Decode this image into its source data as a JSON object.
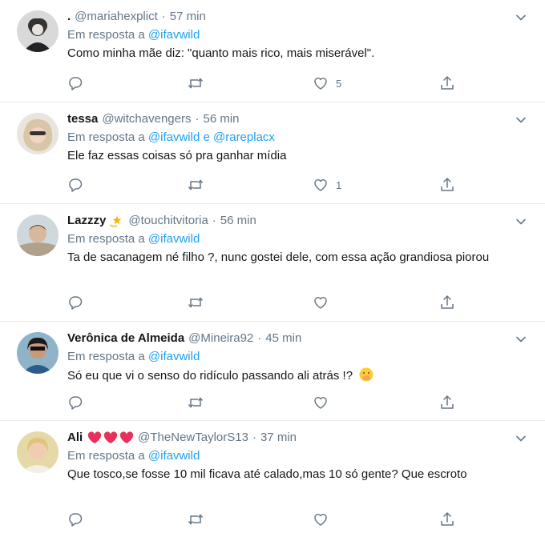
{
  "reply_prefix": "Em resposta a",
  "reply_joiner": "e",
  "tweets": [
    {
      "name": ".",
      "handle": "@mariahexplict",
      "time": "57 min",
      "reply_to": [
        "@ifavwild"
      ],
      "text": "Como minha mãe diz: \"quanto mais rico, mais miserável\".",
      "likes": "5",
      "avatar_icon": "avatar-photo"
    },
    {
      "name": "tessa",
      "handle": "@witchavengers",
      "time": "56 min",
      "reply_to": [
        "@ifavwild",
        "@rareplacx"
      ],
      "text": "Ele faz essas coisas só pra ganhar mídia",
      "likes": "1",
      "avatar_icon": "avatar-photo"
    },
    {
      "name": "Lazzzy",
      "handle": "@touchitvitoria",
      "time": "56 min",
      "reply_to": [
        "@ifavwild"
      ],
      "text": "Ta de sacanagem né filho ?, nunc gostei dele, com essa ação grandiosa piorou",
      "likes": "",
      "avatar_icon": "avatar-photo",
      "name_emoji": "dizzy-star-emoji"
    },
    {
      "name": "Verônica de Almeida",
      "handle": "@Mineira92",
      "time": "45 min",
      "reply_to": [
        "@ifavwild"
      ],
      "text": "Só eu que vi o senso do ridículo passando ali atrás !?",
      "likes": "",
      "avatar_icon": "avatar-photo",
      "text_emoji": "face-with-hand-over-mouth-emoji"
    },
    {
      "name": "Ali",
      "handle": "@TheNewTaylorS13",
      "time": "37 min",
      "reply_to": [
        "@ifavwild"
      ],
      "text": "Que tosco,se fosse 10 mil ficava até calado,mas 10 só gente? Que escroto",
      "likes": "",
      "avatar_icon": "avatar-photo",
      "name_emoji": "hearts-emoji"
    }
  ],
  "colors": {
    "link": "#1da1f2",
    "secondary_text": "#657786",
    "primary_text": "#14171a",
    "divider": "#e6ecf0"
  }
}
